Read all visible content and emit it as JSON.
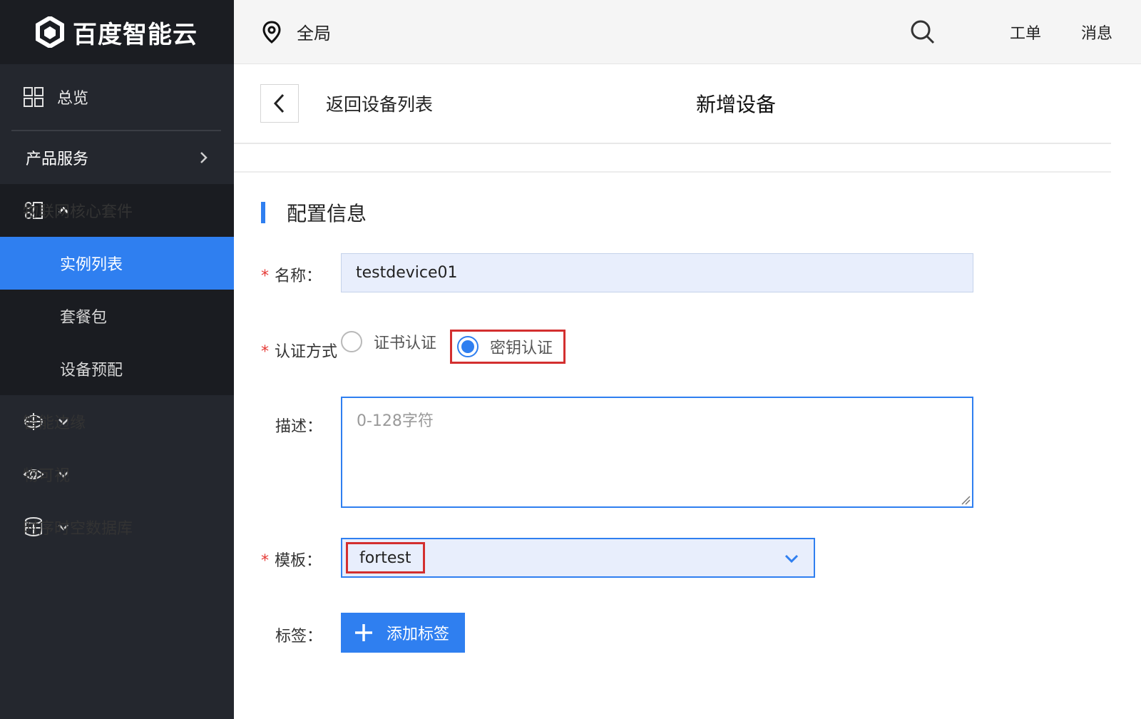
{
  "brand": {
    "name": "百度智能云"
  },
  "sidebar": {
    "overview_label": "总览",
    "products_label": "产品服务",
    "group": {
      "label": "物联网核心套件",
      "children": [
        {
          "label": "实例列表",
          "active": true
        },
        {
          "label": "套餐包",
          "active": false
        },
        {
          "label": "设备预配",
          "active": false
        }
      ]
    },
    "items": [
      {
        "label": "智能边缘",
        "icon": "edge-icon"
      },
      {
        "label": "物可视",
        "icon": "eye-icon"
      },
      {
        "label": "时序时空数据库",
        "icon": "database-icon"
      }
    ]
  },
  "topbar": {
    "region": "全局",
    "ticket_label": "工单",
    "message_label": "消息"
  },
  "header": {
    "back_label": "返回设备列表",
    "page_title": "新增设备"
  },
  "form": {
    "section_title": "配置信息",
    "name": {
      "label": "名称：",
      "value": "testdevice01"
    },
    "auth": {
      "label": "认证方式",
      "options": [
        {
          "label": "证书认证",
          "checked": false
        },
        {
          "label": "密钥认证",
          "checked": true
        }
      ]
    },
    "description": {
      "label": "描述：",
      "placeholder": "0-128字符"
    },
    "template": {
      "label": "模板：",
      "value": "fortest"
    },
    "tags": {
      "label": "标签：",
      "add_button": "添加标签"
    }
  },
  "colors": {
    "accent": "#2f7ff0",
    "sidebar": "#24272e",
    "highlight_border": "#d32f2f"
  }
}
